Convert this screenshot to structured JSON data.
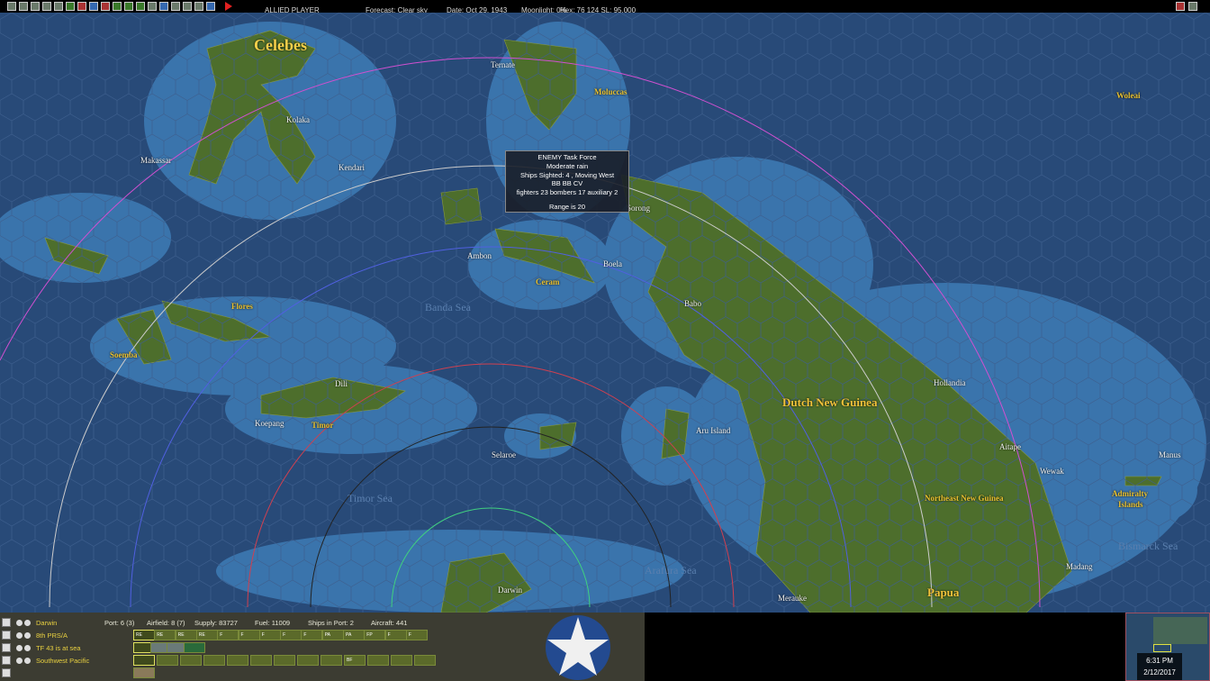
{
  "topbar": {
    "player": "ALLIED PLAYER",
    "forecast": "Forecast: Clear sky",
    "date": "Date: Oct 29, 1943",
    "moonlight": "Moonlight: 0%",
    "hex": "Hex: 76 124  SL: 95,000"
  },
  "map": {
    "labels": {
      "celebes": "Celebes",
      "ternate": "Ternate",
      "moluccas": "Moluccas",
      "woleai": "Woleai",
      "kolaka": "Kolaka",
      "makassar": "Makassar",
      "kendari": "Kendari",
      "sorong": "Sorong",
      "ambon": "Ambon",
      "boela": "Boela",
      "ceram": "Ceram",
      "babo": "Babo",
      "banda_sea": "Banda Sea",
      "flores": "Flores",
      "soemba": "Soemba",
      "dili": "Dili",
      "koepang": "Koepang",
      "timor": "Timor",
      "selaroe": "Selaroe",
      "aru_island": "Aru Island",
      "dutch_new_guinea": "Dutch New Guinea",
      "hollandia": "Hollandia",
      "aitape": "Aitape",
      "wewak": "Wewak",
      "manus": "Manus",
      "admiralty": "Admiralty",
      "islands": "Islands",
      "northeast_new_guinea": "Northeast New Guinea",
      "bismarck_sea": "Bismarck Sea",
      "timor_sea": "Timor Sea",
      "arafura_sea": "Arafura Sea",
      "darwin": "Darwin",
      "merauke": "Merauke",
      "madang": "Madang",
      "papua": "Papua"
    },
    "tooltip": {
      "line1": "ENEMY Task Force",
      "line2": "Moderate rain",
      "line3": "Ships Sighted: 4 , Moving West",
      "line4": "BB BB CV",
      "line5": "fighters 23  bombers 17  auxiliary 2",
      "line6": "Range is 20"
    }
  },
  "panel": {
    "base": "Darwin",
    "air_unit": "8th PRS/A",
    "task_force": "TF 43 is at sea",
    "command": "Southwest Pacific",
    "port": "Port: 6 (3)",
    "airfield": "Airfield: 8 (7)",
    "supply": "Supply: 83727",
    "fuel": "Fuel: 11009",
    "ships_in_port": "Ships in Port: 2",
    "aircraft": "Aircraft: 441",
    "air_slots": [
      "RE",
      "RE",
      "RE",
      "RE",
      "F",
      "F",
      "F",
      "F",
      "F",
      "PA",
      "PA",
      "FP",
      "F",
      "F"
    ],
    "ship_slots": 4,
    "cmd_slots": [
      "",
      "",
      "",
      "",
      "",
      "",
      "",
      "",
      "",
      "BF",
      "",
      "",
      ""
    ]
  },
  "clock": {
    "time": "6:31 PM",
    "date": "2/12/2017"
  },
  "colors": {
    "ocean": "#284a78",
    "shallow": "#3a74ac",
    "land": "#4a6a2a",
    "range_magenta": "#d050d0",
    "range_white": "#cccccc",
    "range_blue": "#5060e0",
    "range_red": "#d04050",
    "range_green": "#40d080"
  }
}
